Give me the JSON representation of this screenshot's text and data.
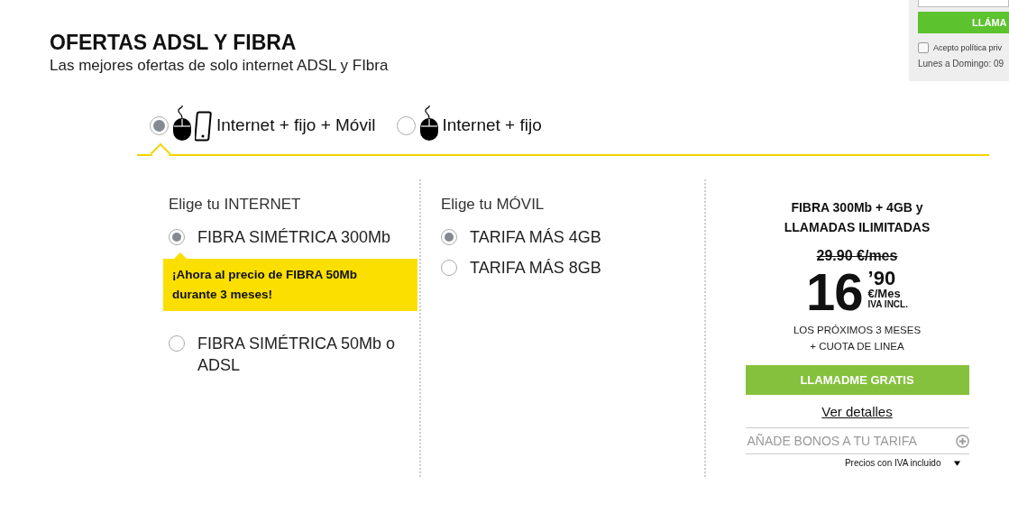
{
  "header": {
    "title": "OFERTAS ADSL Y FIBRA",
    "subtitle": "Las mejores ofertas de solo internet ADSL y FIbra"
  },
  "callback_widget": {
    "button": "LLÁMA",
    "checkbox": {
      "label": "Acepto política priv",
      "checked": false
    },
    "hours": "Lunes a Domingo: 09"
  },
  "plan_tabs": [
    {
      "label": "Internet + fijo + Móvil",
      "selected": true,
      "kind": "mobile"
    },
    {
      "label": "Internet + fijo",
      "selected": false,
      "kind": "fixed"
    }
  ],
  "internet": {
    "heading": "Elige tu INTERNET",
    "options": [
      {
        "label": "FIBRA SIMÉTRICA 300Mb",
        "selected": true,
        "promo": "¡Ahora al precio de FIBRA 50Mb durante 3 meses!"
      },
      {
        "label": "FIBRA SIMÉTRICA 50Mb o ADSL",
        "selected": false
      }
    ]
  },
  "mobile": {
    "heading": "Elige tu MÓVIL",
    "options": [
      {
        "label": "TARIFA MÁS 4GB",
        "selected": true
      },
      {
        "label": "TARIFA MÁS 8GB",
        "selected": false
      }
    ]
  },
  "offer": {
    "title_lines": [
      "FIBRA 300Mb + 4GB y",
      "LLAMADAS ILIMITADAS"
    ],
    "old_price": "29.90 €/mes",
    "price_int": "16",
    "price_dec": "’90",
    "unit": "€/Mes",
    "tax": "IVA INCL.",
    "note_lines": [
      "LOS PRÓXIMOS 3 MESES",
      "+ CUOTA DE LINEA"
    ],
    "button": "LLAMADME GRATIS",
    "details_link": "Ver detalles",
    "addons": "AÑADE BONOS A TU TARIFA",
    "tax_note": "Precios con IVA incluido"
  }
}
